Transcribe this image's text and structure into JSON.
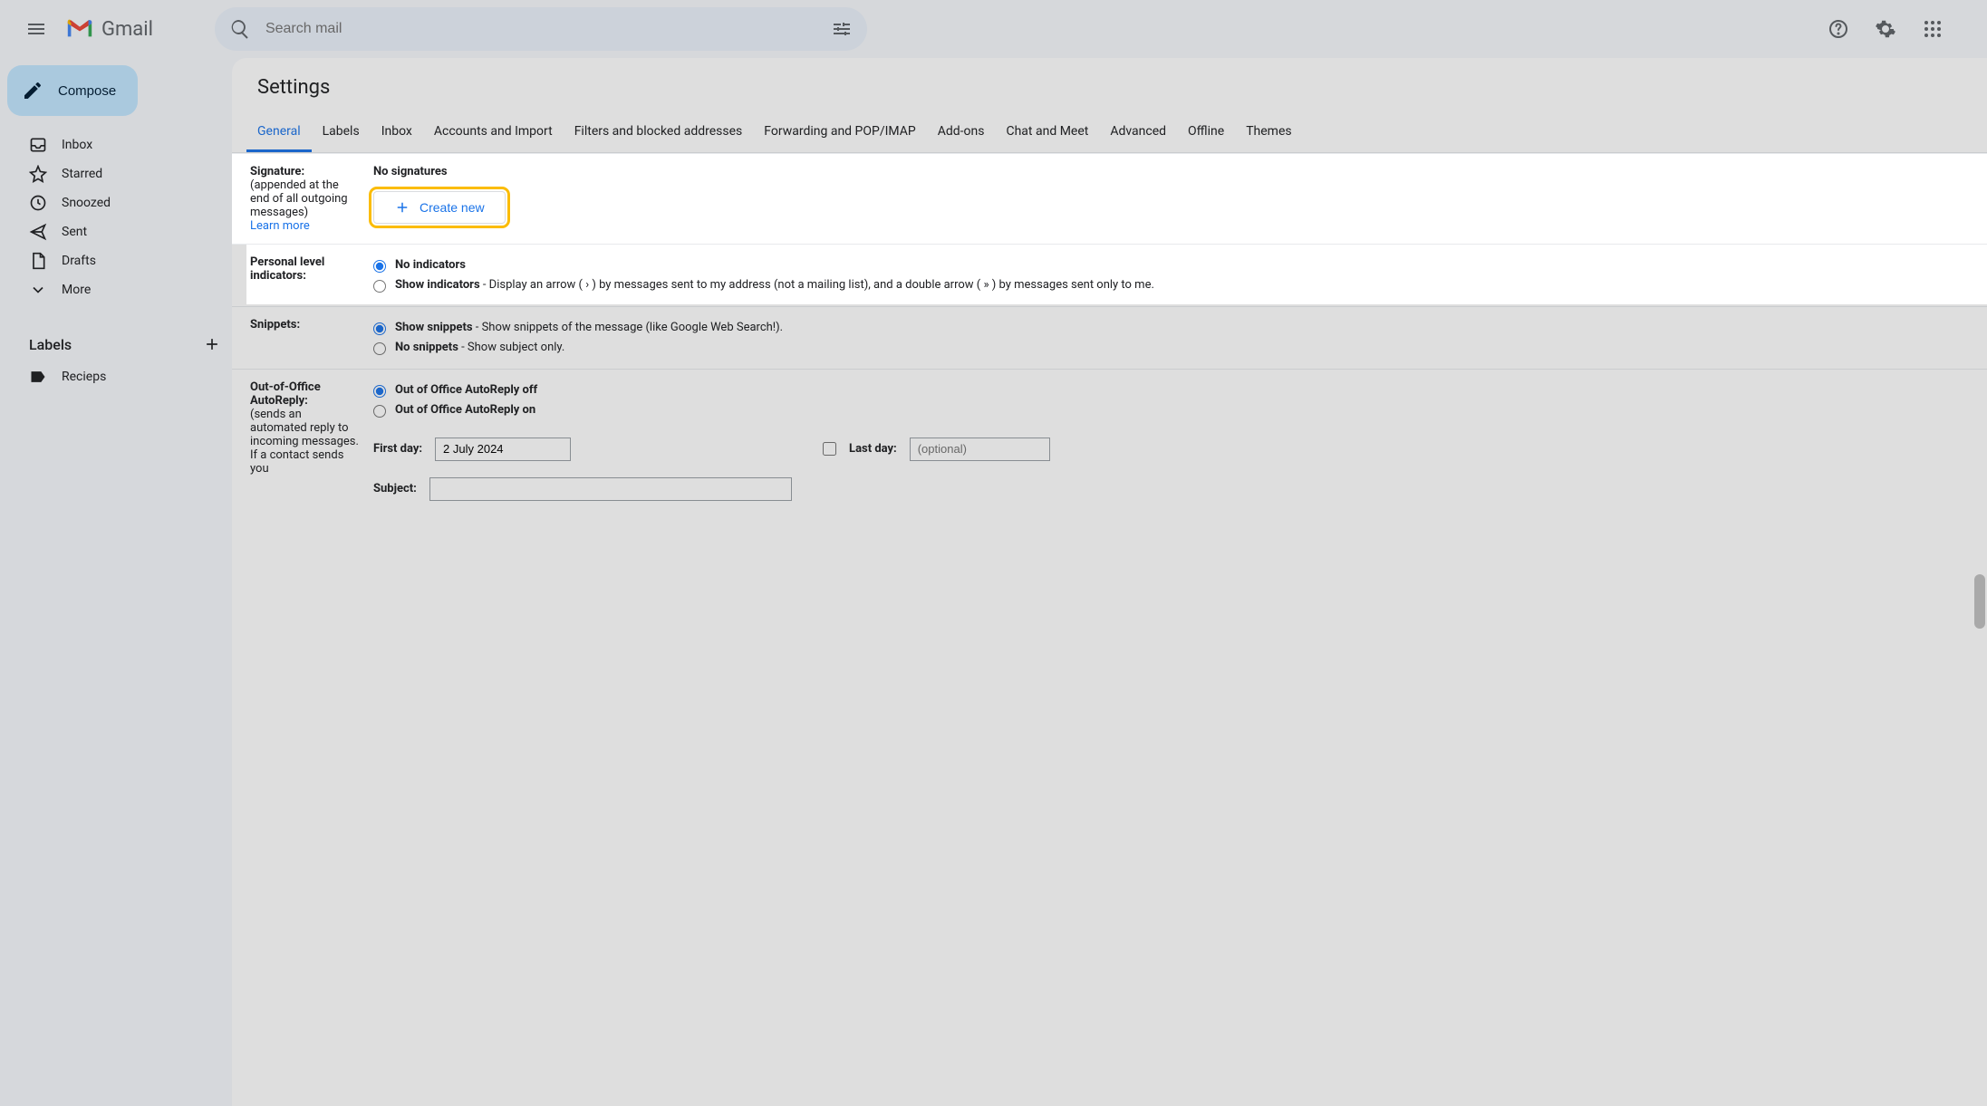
{
  "header": {
    "product_name": "Gmail",
    "search_placeholder": "Search mail"
  },
  "sidebar": {
    "compose_label": "Compose",
    "nav": [
      {
        "label": "Inbox"
      },
      {
        "label": "Starred"
      },
      {
        "label": "Snoozed"
      },
      {
        "label": "Sent"
      },
      {
        "label": "Drafts"
      },
      {
        "label": "More"
      }
    ],
    "labels_header": "Labels",
    "labels": [
      {
        "label": "Recieps"
      }
    ]
  },
  "settings": {
    "title": "Settings",
    "tabs": [
      "General",
      "Labels",
      "Inbox",
      "Accounts and Import",
      "Filters and blocked addresses",
      "Forwarding and POP/IMAP",
      "Add-ons",
      "Chat and Meet",
      "Advanced",
      "Offline",
      "Themes"
    ],
    "active_tab": "General",
    "signature": {
      "title": "Signature:",
      "sub": "(appended at the end of all outgoing messages)",
      "learn_more": "Learn more",
      "status": "No signatures",
      "create_label": "Create new"
    },
    "personal_indicators": {
      "title": "Personal level indicators:",
      "none_label": "No indicators",
      "show_label": "Show indicators",
      "show_desc": " - Display an arrow ( › ) by messages sent to my address (not a mailing list), and a double arrow ( » ) by messages sent only to me."
    },
    "snippets": {
      "title": "Snippets:",
      "show_label": "Show snippets",
      "show_desc": " - Show snippets of the message (like Google Web Search!).",
      "none_label": "No snippets",
      "none_desc": " - Show subject only."
    },
    "ooo": {
      "title": "Out-of-Office AutoReply:",
      "sub": "(sends an automated reply to incoming messages. If a contact sends you",
      "off_label": "Out of Office AutoReply off",
      "on_label": "Out of Office AutoReply on",
      "first_day_label": "First day:",
      "first_day_value": "2 July 2024",
      "last_day_label": "Last day:",
      "last_day_placeholder": "(optional)",
      "subject_label": "Subject:"
    }
  }
}
